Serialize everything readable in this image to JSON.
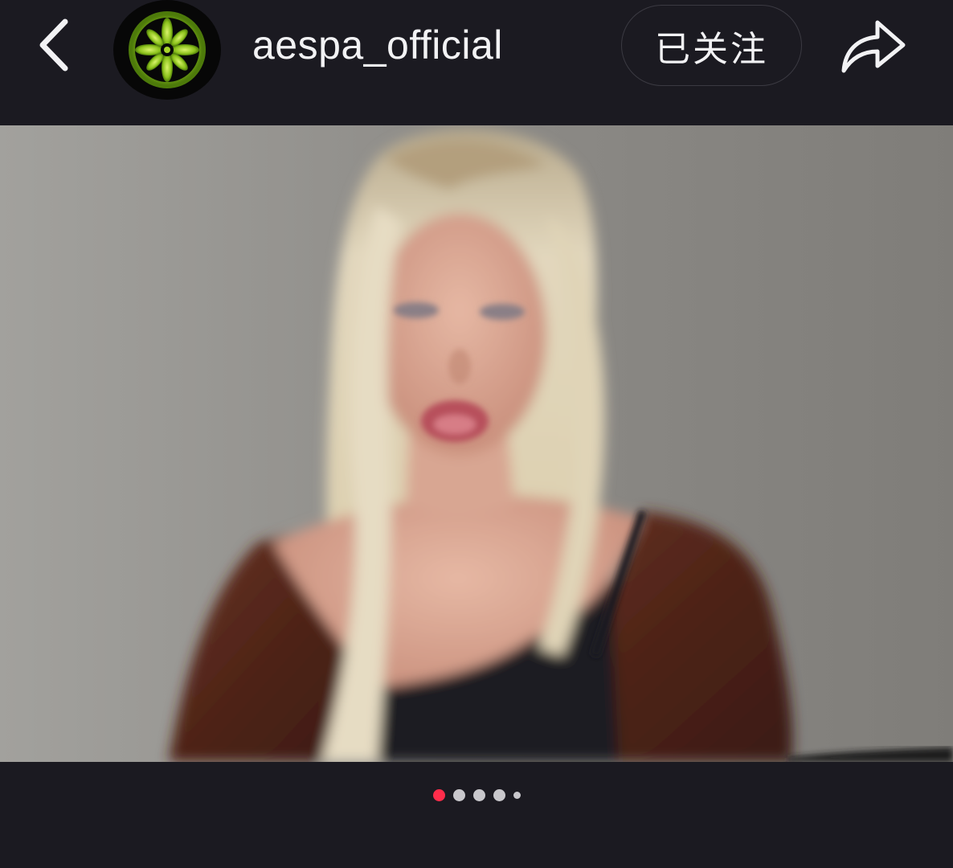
{
  "header": {
    "back_icon": "chevron-left-icon",
    "avatar_icon": "green-flower-logo",
    "username": "aespa_official",
    "follow_label": "已关注",
    "share_icon": "share-arrow-icon"
  },
  "post": {
    "image_description_icon": "portrait-photo",
    "carousel": {
      "total": 5,
      "current": 1
    }
  },
  "colors": {
    "background": "#1b1a21",
    "text": "#f2f2f4",
    "active_dot": "#ff2d4b",
    "inactive_dot": "#c9c8cc",
    "avatar_green": "#a6d32a"
  }
}
